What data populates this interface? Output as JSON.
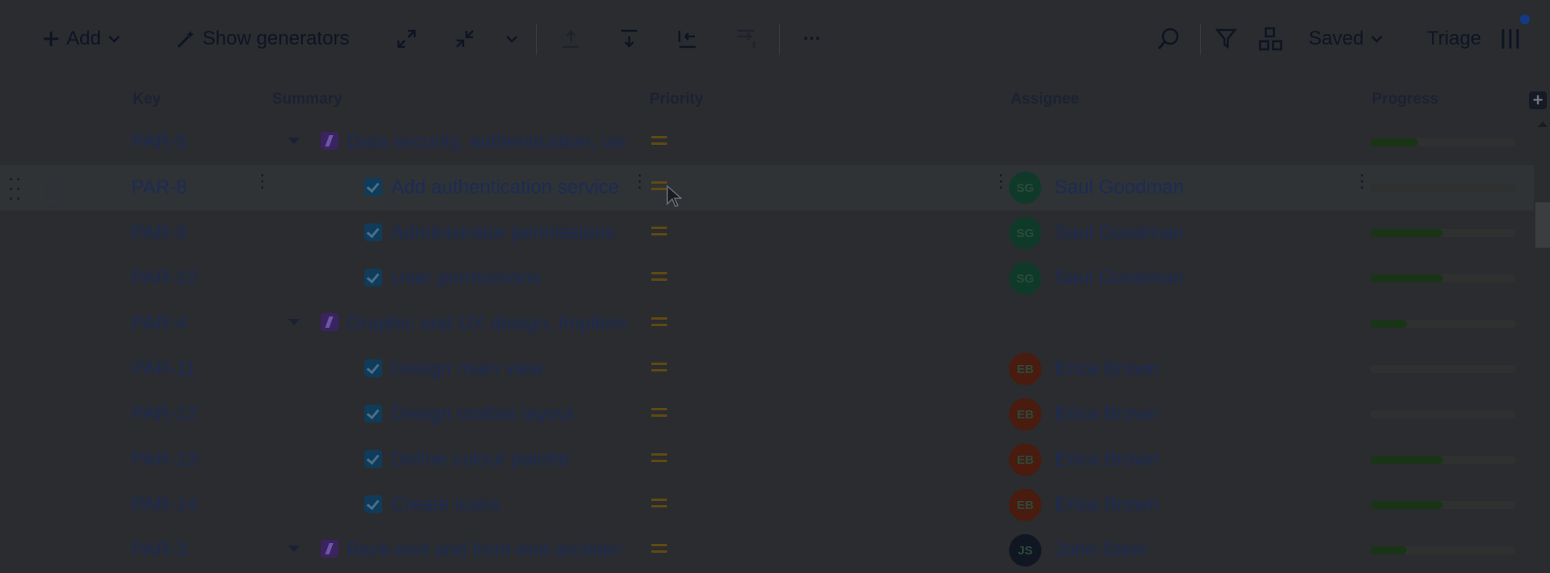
{
  "toolbar": {
    "add_label": "Add",
    "show_generators_label": "Show generators",
    "saved_label": "Saved",
    "triage_label": "Triage",
    "more_label": "···"
  },
  "columns": {
    "key": "Key",
    "summary": "Summary",
    "priority": "Priority",
    "assignee": "Assignee",
    "progress": "Progress"
  },
  "rows": [
    {
      "key": "PAR-5",
      "type": "epic",
      "summary": "Data security, authentication, use",
      "assignee_initials": "",
      "assignee": "",
      "progress": 0.33
    },
    {
      "key": "PAR-8",
      "type": "task",
      "summary": "Add authentication service",
      "assignee_initials": "SG",
      "assignee": "Saul Goodman",
      "progress": 0.0
    },
    {
      "key": "PAR-9",
      "type": "task",
      "summary": "Administrator permissions",
      "assignee_initials": "SG",
      "assignee": "Saul Goodman",
      "progress": 0.5
    },
    {
      "key": "PAR-10",
      "type": "task",
      "summary": "User permissions",
      "assignee_initials": "SG",
      "assignee": "Saul Goodman",
      "progress": 0.5
    },
    {
      "key": "PAR-4",
      "type": "epic",
      "summary": "Graphic and UX design, Impleme",
      "assignee_initials": "",
      "assignee": "",
      "progress": 0.25
    },
    {
      "key": "PAR-11",
      "type": "task",
      "summary": "Design main view",
      "assignee_initials": "EB",
      "assignee": "Erica Brown",
      "progress": 0.0
    },
    {
      "key": "PAR-12",
      "type": "task",
      "summary": "Design toolbar layout",
      "assignee_initials": "EB",
      "assignee": "Erica Brown",
      "progress": 0.0
    },
    {
      "key": "PAR-13",
      "type": "task",
      "summary": "Define colour palette",
      "assignee_initials": "EB",
      "assignee": "Erica Brown",
      "progress": 0.5
    },
    {
      "key": "PAR-14",
      "type": "task",
      "summary": "Create icons",
      "assignee_initials": "EB",
      "assignee": "Erica Brown",
      "progress": 0.5
    },
    {
      "key": "PAR-3",
      "type": "epic",
      "summary": "Back-end and front-end architec",
      "assignee_initials": "JS",
      "assignee": "John Steel",
      "progress": 0.25
    }
  ],
  "avatar_colors": {
    "SG": "#0f3a2a",
    "EB": "#4a1b0f",
    "JS": "#111722"
  },
  "colors": {
    "priority": "#5e4a12",
    "progress_fill": "#1a3418"
  }
}
